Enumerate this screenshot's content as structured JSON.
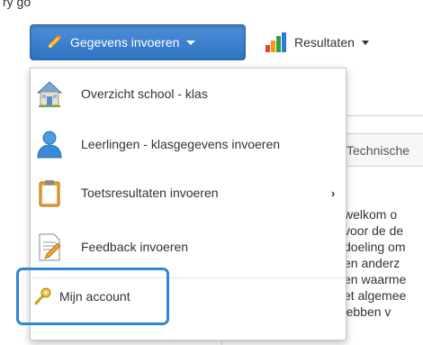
{
  "top_fragment": "ry go",
  "toolbar": {
    "primary_label": "Gegevens invoeren",
    "results_label": "Resultaten"
  },
  "menu": {
    "items": [
      {
        "label": "Overzicht school - klas",
        "icon": "school-house-icon"
      },
      {
        "label": "Leerlingen - klasgegevens invoeren",
        "icon": "student-person-icon"
      },
      {
        "label": "Toetsresultaten invoeren",
        "icon": "clipboard-icon",
        "submenu_indicator": "›"
      },
      {
        "label": "Feedback invoeren",
        "icon": "feedback-document-icon"
      }
    ],
    "account_label": "Mijn account",
    "account_icon": "key-icon"
  },
  "background": {
    "tab_label": "Technische",
    "text_lines": [
      "welkom o",
      "voor de de",
      "doeling om",
      "en anderz",
      "en waarme",
      "et algemee",
      "leerkrachten, hebben v"
    ]
  },
  "colors": {
    "primary_button": "#3479c9",
    "highlight_border": "#2f86d4"
  }
}
